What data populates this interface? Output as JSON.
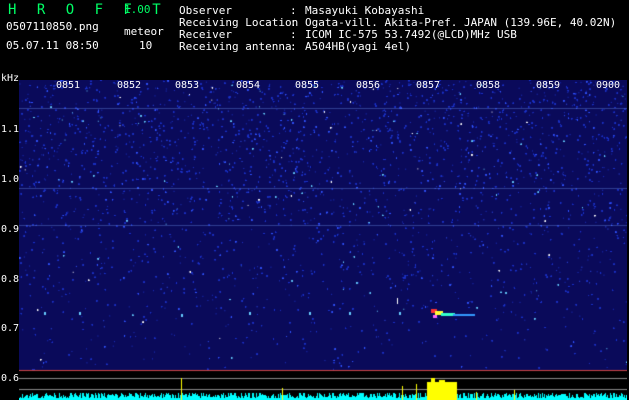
{
  "header": {
    "app_title": "H R O F F T",
    "app_version": "1.00",
    "filename": "0507110850.png",
    "meteor_label": "meteor",
    "timestamp": "05.07.11 08:50",
    "meteor_count": "10"
  },
  "station_info": [
    {
      "label": "Observer",
      "value": "Masayuki Kobayashi"
    },
    {
      "label": "Receiving Location",
      "value": "Ogata-vill. Akita-Pref. JAPAN (139.96E, 40.02N)"
    },
    {
      "label": "Receiver",
      "value": "ICOM IC-575 53.7492(@LCD)MHz USB"
    },
    {
      "label": "Receiving antenna",
      "value": "A504HB(yagi 4el)"
    }
  ],
  "spectrogram": {
    "y_unit": "kHz",
    "y_ticks": [
      "1.1",
      "1.0",
      "0.9",
      "0.8",
      "0.7",
      "0.6"
    ],
    "x_ticks": [
      "0851",
      "0852",
      "0853",
      "0854",
      "0855",
      "0856",
      "0857",
      "0858",
      "0859",
      "0900"
    ],
    "colors": {
      "background": "#0a0a5a",
      "noise": "#1a2fd0",
      "grid_line": "#cc4444",
      "activity_bar": "#00ffff",
      "event": "#ffff00",
      "header_text": "#00ff66"
    }
  }
}
